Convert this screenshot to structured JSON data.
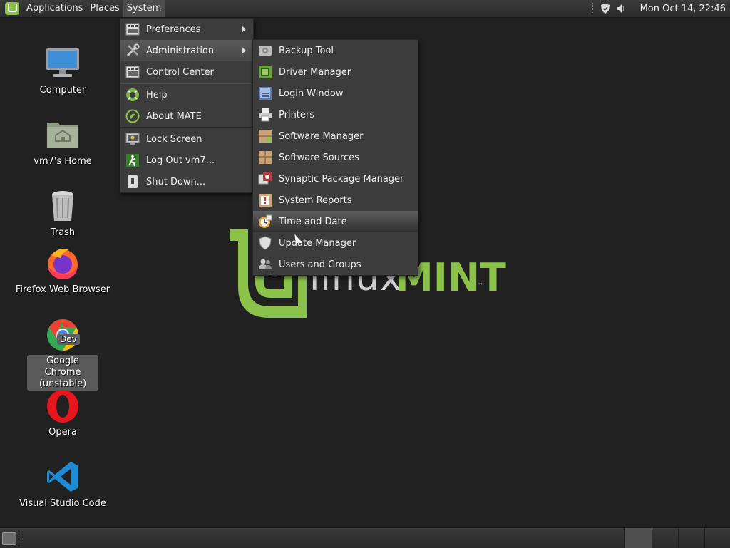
{
  "top_panel": {
    "menus": [
      "Applications",
      "Places",
      "System"
    ],
    "clock": "Mon Oct 14, 22:46",
    "tray_icons": [
      "shield-icon",
      "volume-icon"
    ]
  },
  "desktop": {
    "icons": [
      {
        "label": "Computer",
        "icon": "computer-icon"
      },
      {
        "label": "vm7's Home",
        "icon": "home-folder-icon"
      },
      {
        "label": "Trash",
        "icon": "trash-icon"
      },
      {
        "label": "Firefox Web Browser",
        "icon": "firefox-icon"
      },
      {
        "label": "Google Chrome (unstable)",
        "icon": "chrome-dev-icon",
        "badge": "Dev"
      },
      {
        "label": "Opera",
        "icon": "opera-icon"
      },
      {
        "label": "Visual Studio Code",
        "icon": "vscode-icon"
      }
    ],
    "wallpaper": {
      "word_left": "linux",
      "word_right": "MINT",
      "tm": "™"
    }
  },
  "system_menu": {
    "items": [
      {
        "label": "Preferences",
        "submenu": true
      },
      {
        "label": "Administration",
        "submenu": true
      },
      {
        "label": "Control Center"
      },
      {
        "label": "Help"
      },
      {
        "label": "About MATE"
      },
      {
        "label": "Lock Screen"
      },
      {
        "label": "Log Out vm7..."
      },
      {
        "label": "Shut Down..."
      }
    ]
  },
  "admin_menu": {
    "items": [
      {
        "label": "Backup Tool"
      },
      {
        "label": "Driver Manager"
      },
      {
        "label": "Login Window"
      },
      {
        "label": "Printers"
      },
      {
        "label": "Software Manager"
      },
      {
        "label": "Software Sources"
      },
      {
        "label": "Synaptic Package Manager"
      },
      {
        "label": "System Reports"
      },
      {
        "label": "Time and Date"
      },
      {
        "label": "Update Manager"
      },
      {
        "label": "Users and Groups"
      }
    ]
  },
  "colors": {
    "accent": "#8bc34a",
    "panel": "#2e2e2e",
    "menu": "#3c3c3c",
    "desktop": "#212121"
  }
}
